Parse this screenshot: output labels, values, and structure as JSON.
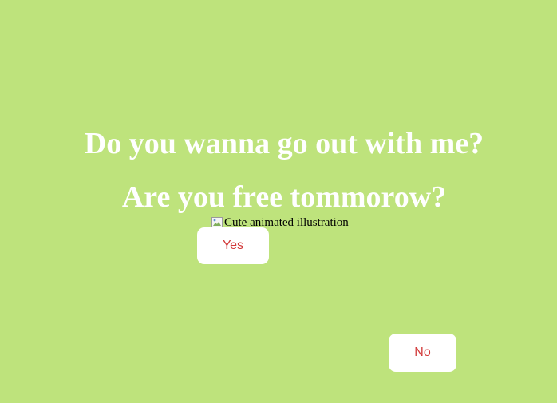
{
  "page": {
    "background_color": "#bee37c",
    "question_line_1": "Do you wanna go out with me?",
    "question_line_2": "Are you free tommorow?",
    "image_alt": "Cute animated illustration",
    "image_icon": "broken-image-icon"
  },
  "buttons": {
    "yes_label": "Yes",
    "no_label": "No",
    "label_color": "#d23a3a",
    "background_color": "#ffffff"
  }
}
